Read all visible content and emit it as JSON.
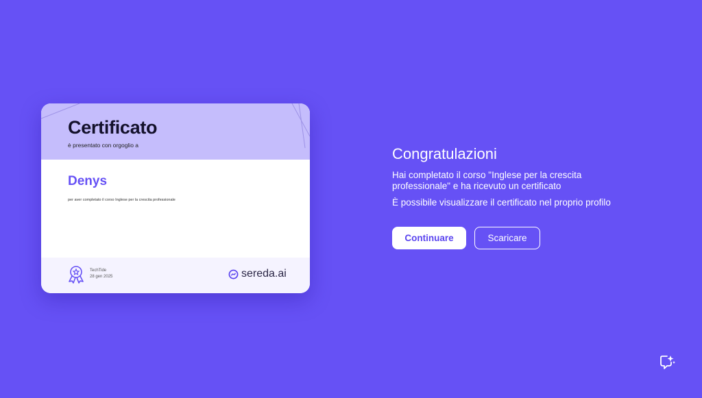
{
  "certificate": {
    "title": "Certificato",
    "subtitle": "è presentato con orgoglio a",
    "recipient": "Denys",
    "description": "per aver completato il corso Inglese per la crescita professionale",
    "issuer": "TechTide",
    "date": "28 gen 2025",
    "brand": "sereda.ai",
    "badge_icon": "award-ribbon-icon"
  },
  "panel": {
    "heading": "Congratulazioni",
    "message": "Hai completato il corso \"Inglese per la crescita professionale\" e ha ricevuto un certificato",
    "note": "È possibile visualizzare il certificato nel proprio profilo",
    "continue_label": "Continuare",
    "download_label": "Scaricare"
  },
  "colors": {
    "background": "#6651f5",
    "header": "#c5bdfc",
    "accent": "#6651f5"
  },
  "assistant": {
    "icon": "ai-sparkle-chat-icon"
  }
}
